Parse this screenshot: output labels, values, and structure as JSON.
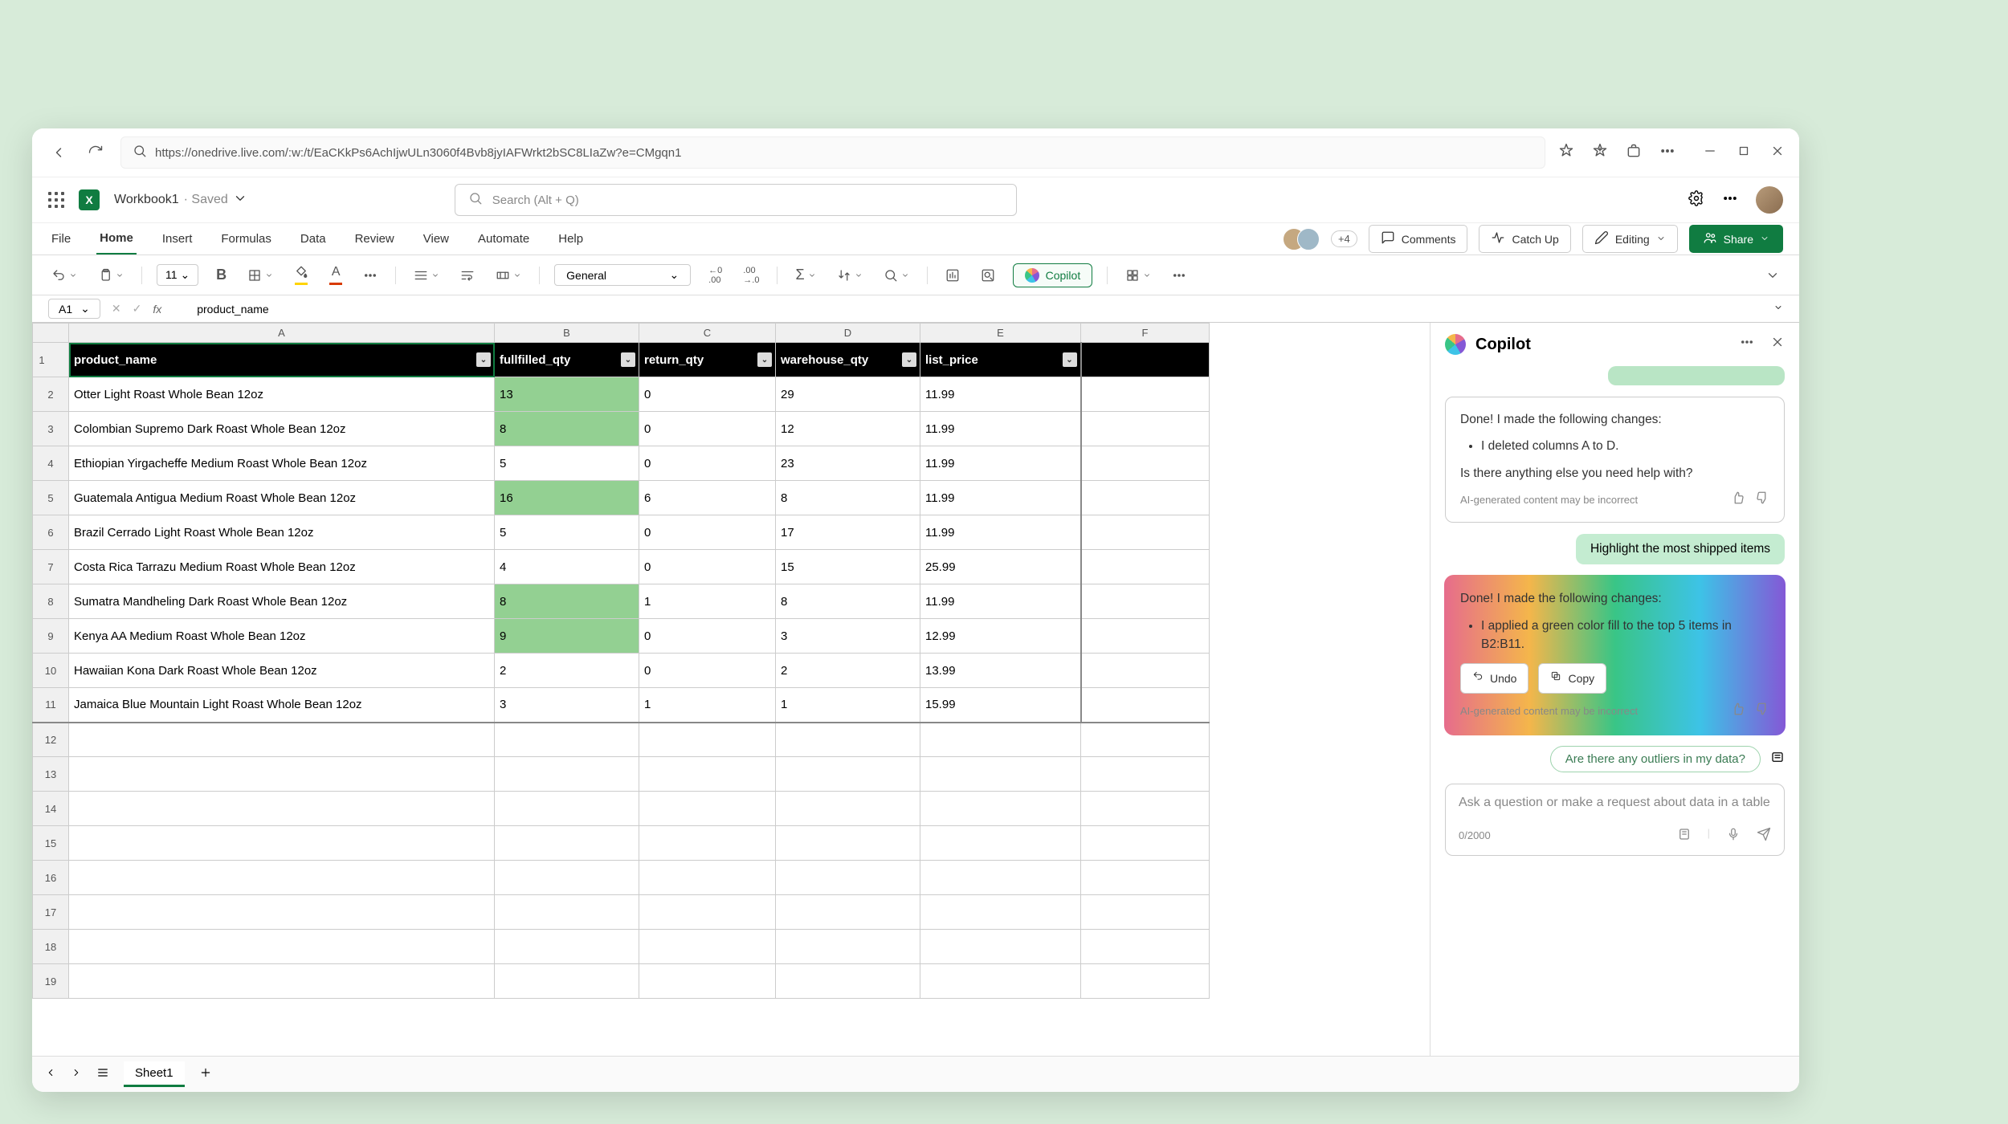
{
  "browser": {
    "url": "https://onedrive.live.com/:w:/t/EaCKkPs6AchIjwULn3060f4Bvb8jyIAFWrkt2bSC8LIaZw?e=CMgqn1"
  },
  "doc": {
    "name": "Workbook1",
    "status": "· Saved"
  },
  "search": {
    "placeholder": "Search (Alt + Q)"
  },
  "tabs": [
    "File",
    "Home",
    "Insert",
    "Formulas",
    "Data",
    "Review",
    "View",
    "Automate",
    "Help"
  ],
  "active_tab": "Home",
  "presence": {
    "extra": "+4"
  },
  "actions": {
    "comments": "Comments",
    "catchup": "Catch Up",
    "editing": "Editing",
    "share": "Share"
  },
  "toolbar": {
    "font_size": "11",
    "bold": "B",
    "number_format": "General",
    "copilot": "Copilot"
  },
  "formula_bar": {
    "cell_ref": "A1",
    "value": "product_name"
  },
  "columns": [
    "A",
    "B",
    "C",
    "D",
    "E",
    "F"
  ],
  "col_widths": {
    "A": 530,
    "B": 180,
    "C": 170,
    "D": 180,
    "E": 200,
    "F": 160
  },
  "headers": [
    "product_name",
    "fullfilled_qty",
    "return_qty",
    "warehouse_qty",
    "list_price"
  ],
  "rows": [
    {
      "n": 2,
      "a": "Otter Light Roast Whole Bean 12oz",
      "b": "13",
      "c": "0",
      "d": "29",
      "e": "11.99",
      "hl": true
    },
    {
      "n": 3,
      "a": "Colombian Supremo Dark Roast Whole Bean 12oz",
      "b": "8",
      "c": "0",
      "d": "12",
      "e": "11.99",
      "hl": true
    },
    {
      "n": 4,
      "a": "Ethiopian Yirgacheffe Medium Roast Whole Bean 12oz",
      "b": "5",
      "c": "0",
      "d": "23",
      "e": "11.99",
      "hl": false
    },
    {
      "n": 5,
      "a": "Guatemala Antigua Medium Roast Whole Bean 12oz",
      "b": "16",
      "c": "6",
      "d": "8",
      "e": "11.99",
      "hl": true
    },
    {
      "n": 6,
      "a": "Brazil Cerrado Light Roast Whole Bean 12oz",
      "b": "5",
      "c": "0",
      "d": "17",
      "e": "11.99",
      "hl": false
    },
    {
      "n": 7,
      "a": "Costa Rica Tarrazu Medium Roast Whole Bean 12oz",
      "b": "4",
      "c": "0",
      "d": "15",
      "e": "25.99",
      "hl": false
    },
    {
      "n": 8,
      "a": "Sumatra Mandheling Dark Roast Whole Bean 12oz",
      "b": "8",
      "c": "1",
      "d": "8",
      "e": "11.99",
      "hl": true
    },
    {
      "n": 9,
      "a": "Kenya AA Medium Roast Whole Bean 12oz",
      "b": "9",
      "c": "0",
      "d": "3",
      "e": "12.99",
      "hl": true
    },
    {
      "n": 10,
      "a": "Hawaiian Kona Dark Roast Whole Bean 12oz",
      "b": "2",
      "c": "0",
      "d": "2",
      "e": "13.99",
      "hl": false
    },
    {
      "n": 11,
      "a": "Jamaica Blue Mountain Light Roast Whole Bean 12oz",
      "b": "3",
      "c": "1",
      "d": "1",
      "e": "15.99",
      "hl": false
    }
  ],
  "empty_rows": [
    12,
    13,
    14,
    15,
    16,
    17,
    18,
    19
  ],
  "sheet": {
    "name": "Sheet1"
  },
  "copilot": {
    "title": "Copilot",
    "msg1": {
      "intro": "Done! I made the following changes:",
      "bullet": "I deleted columns A to D.",
      "follow": "Is there anything else you need help with?",
      "disclaimer": "AI-generated content may be incorrect"
    },
    "user_msg": "Highlight the most shipped items",
    "msg2": {
      "intro": "Done! I made the following changes:",
      "bullet": "I applied a green color fill to the top 5 items in B2:B11.",
      "undo": "Undo",
      "copy": "Copy",
      "disclaimer": "AI-generated content may be incorrect"
    },
    "suggestion": "Are there any outliers in my data?",
    "input_placeholder": "Ask a question or make a request about data in a table",
    "counter": "0/2000"
  }
}
